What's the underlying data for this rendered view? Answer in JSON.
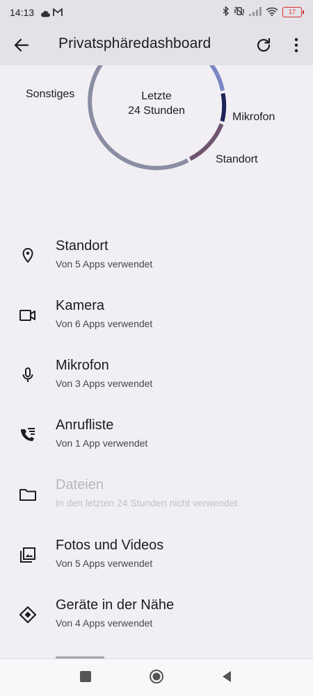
{
  "status_bar": {
    "time": "14:13",
    "battery": "17",
    "battery_color": "#d32f2f"
  },
  "app_bar": {
    "title": "Privatsphäredashboard",
    "back_icon": "arrow-back-icon",
    "refresh_icon": "refresh-icon",
    "more_icon": "more-vert-icon"
  },
  "chart": {
    "center_line1": "Letzte",
    "center_line2": "24 Stunden",
    "labels": {
      "other": "Sonstiges",
      "microphone": "Mikrofon",
      "location": "Standort"
    },
    "segment_colors": {
      "other": "#8b8da3",
      "camera": "#7b86c4",
      "microphone": "#1d2257",
      "location": "#6f5470"
    }
  },
  "permissions": [
    {
      "title": "Standort",
      "subtitle": "Von 5 Apps verwendet",
      "icon": "location-pin-icon",
      "enabled": true
    },
    {
      "title": "Kamera",
      "subtitle": "Von 6 Apps verwendet",
      "icon": "camera-icon",
      "enabled": true
    },
    {
      "title": "Mikrofon",
      "subtitle": "Von 3 Apps verwendet",
      "icon": "microphone-icon",
      "enabled": true
    },
    {
      "title": "Anrufliste",
      "subtitle": "Von 1 App verwendet",
      "icon": "call-log-icon",
      "enabled": true
    },
    {
      "title": "Dateien",
      "subtitle": "In den letzten 24 Stunden nicht verwendet",
      "icon": "folder-icon",
      "enabled": false
    },
    {
      "title": "Fotos und Videos",
      "subtitle": "Von 5 Apps verwendet",
      "icon": "photo-library-icon",
      "enabled": true
    },
    {
      "title": "Geräte in der Nähe",
      "subtitle": "Von 4 Apps verwendet",
      "icon": "nearby-devices-icon",
      "enabled": true
    }
  ],
  "nav_bar": {
    "recent_icon": "recent-apps-icon",
    "home_icon": "home-icon",
    "back_icon": "nav-back-icon"
  }
}
